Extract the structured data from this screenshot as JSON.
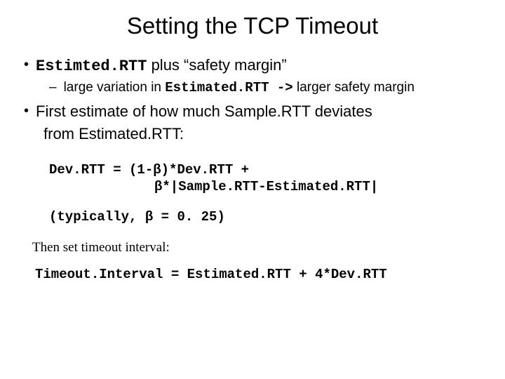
{
  "title": "Setting the TCP Timeout",
  "bullet1": {
    "dot": "•",
    "mono": "Estimted.RTT",
    "rest": " plus “safety margin”"
  },
  "sub1": {
    "dash": "–",
    "pre": "large variation in ",
    "mono": "Estimated.RTT ->",
    "post": " larger safety margin"
  },
  "bullet2": {
    "dot": "•",
    "line1": "First estimate of how much Sample.RTT deviates",
    "line2": "from Estimated.RTT:"
  },
  "formula": {
    "l1a": "Dev.RTT = (1-",
    "beta": "β",
    "l1b": ")*Dev.RTT +",
    "l2a": "*|Sample.RTT-Estimated.RTT|"
  },
  "typically": {
    "pre": "(typically, ",
    "post": " = 0. 25)"
  },
  "thenset": "Then set timeout interval:",
  "timeout": "Timeout.Interval = Estimated.RTT + 4*Dev.RTT"
}
